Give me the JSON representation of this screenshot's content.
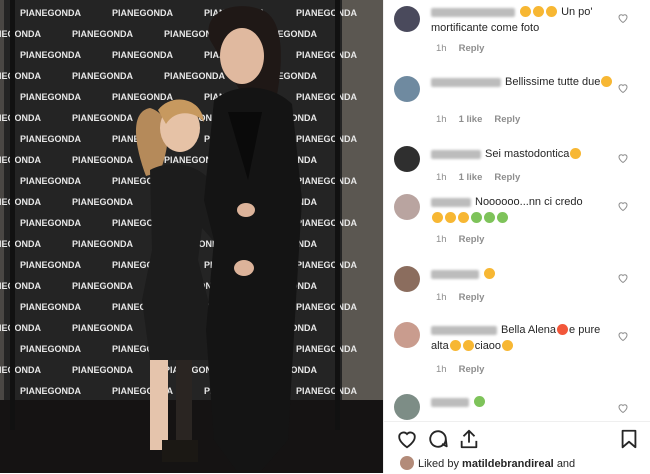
{
  "photo": {
    "backdrop_brand": "PIANEGONDA"
  },
  "comments": [
    {
      "text": "Un po' mortificante come foto",
      "time": "1h",
      "likes": "",
      "reply": "Reply",
      "avatar_color": "#4a4a5c",
      "emojis": [
        "yellow",
        "yellow",
        "yellow"
      ],
      "name_w": 84
    },
    {
      "text": "Bellissime tutte due",
      "time": "1h",
      "likes": "1 like",
      "reply": "Reply",
      "avatar_color": "#6f8aa0",
      "emojis_after": [
        "yellow"
      ],
      "name_w": 70
    },
    {
      "text": "Sei mastodontica",
      "time": "1h",
      "likes": "1 like",
      "reply": "Reply",
      "avatar_color": "#2f2f2f",
      "emojis_after": [
        "yellow"
      ],
      "name_w": 50
    },
    {
      "text": "Noooooo...nn ci credo",
      "time": "1h",
      "likes": "",
      "reply": "Reply",
      "avatar_color": "#b9a4a0",
      "emojis_line2": [
        "yellow",
        "yellow",
        "yellow",
        "green",
        "green",
        "green"
      ],
      "name_w": 40
    },
    {
      "text": "",
      "time": "1h",
      "likes": "",
      "reply": "Reply",
      "avatar_color": "#8b6d5e",
      "emojis_after": [
        "yellow"
      ],
      "name_w": 48
    },
    {
      "text": "Bella Alena",
      "text2": "e pure alta",
      "text3": "ciaoo",
      "time": "1h",
      "likes": "",
      "reply": "Reply",
      "avatar_color": "#c99c8e",
      "name_w": 66
    },
    {
      "text": "",
      "time": "",
      "likes": "",
      "reply": "",
      "avatar_color": "#7d8d86",
      "emojis_after": [
        "green"
      ],
      "name_w": 38
    }
  ],
  "footer": {
    "liked_by_prefix": "Liked by",
    "liked_by_user": "matildebrandireal",
    "liked_by_suffix": "and"
  },
  "icons": [
    "heart-outline-icon",
    "comment-bubble-icon",
    "share-arrow-icon",
    "bookmark-icon"
  ]
}
